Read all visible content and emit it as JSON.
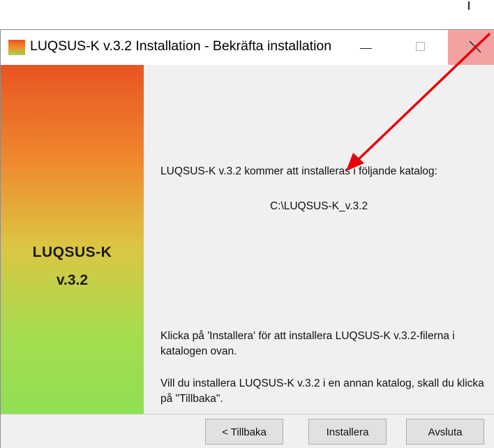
{
  "window": {
    "title": "LUQSUS-K v.3.2 Installation - Bekräfta installation",
    "icon": "app-gradient-icon"
  },
  "sidebar": {
    "brand_name": "LUQSUS-K",
    "brand_version": "v.3.2"
  },
  "content": {
    "intro": "LUQSUS-K v.3.2 kommer att installeras i följande katalog:",
    "path": "C:\\LUQSUS-K_v.3.2",
    "instruction_install": "Klicka på 'Installera' för att installera LUQSUS-K v.3.2-filerna i katalogen ovan.",
    "instruction_back": "Vill du installera LUQSUS-K v.3.2 i en annan katalog, skall du klicka på \"Tillbaka\"."
  },
  "buttons": {
    "back": "< Tillbaka",
    "install": "Installera",
    "exit": "Avsluta"
  },
  "colors": {
    "sidebar_top": "#e85422",
    "sidebar_bottom": "#8fe052",
    "close_hover": "#f3a2a2",
    "annotation_arrow": "#e8000b"
  }
}
